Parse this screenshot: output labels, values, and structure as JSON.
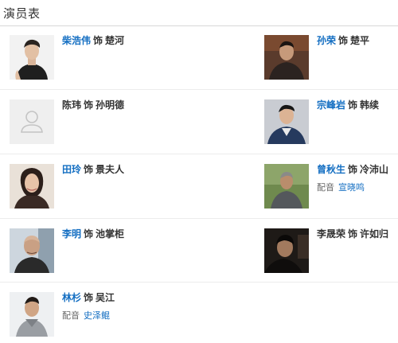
{
  "section": {
    "title": "演员表"
  },
  "colors": {
    "link": "#136ec2",
    "text": "#333333",
    "rule": "#d8d8d8",
    "placeholder_bg": "#efefef"
  },
  "cast": [
    {
      "actor": "柴浩伟",
      "as": "饰",
      "role": "楚河",
      "actor_linked": true,
      "photo": "portrait"
    },
    {
      "actor": "孙荣",
      "as": "饰",
      "role": "楚平",
      "actor_linked": true,
      "photo": "portrait"
    },
    {
      "actor": "陈玮",
      "as": "饰",
      "role": "孙明德",
      "actor_linked": false,
      "photo": "placeholder-person-icon"
    },
    {
      "actor": "宗峰岩",
      "as": "饰",
      "role": "韩续",
      "actor_linked": true,
      "photo": "portrait"
    },
    {
      "actor": "田玲",
      "as": "饰",
      "role": "景夫人",
      "actor_linked": true,
      "photo": "portrait"
    },
    {
      "actor": "曾秋生",
      "as": "饰",
      "role": "冷沛山",
      "actor_linked": true,
      "photo": "portrait",
      "dub_label": "配音",
      "dubber": "宣晓鸣"
    },
    {
      "actor": "李明",
      "as": "饰",
      "role": "池掌柜",
      "actor_linked": true,
      "photo": "portrait"
    },
    {
      "actor": "李晟荣",
      "as": "饰",
      "role": "许如归",
      "actor_linked": false,
      "photo": "portrait"
    },
    {
      "actor": "林杉",
      "as": "饰",
      "role": "吴江",
      "actor_linked": true,
      "photo": "portrait",
      "dub_label": "配音",
      "dubber": "史泽鲲"
    }
  ]
}
